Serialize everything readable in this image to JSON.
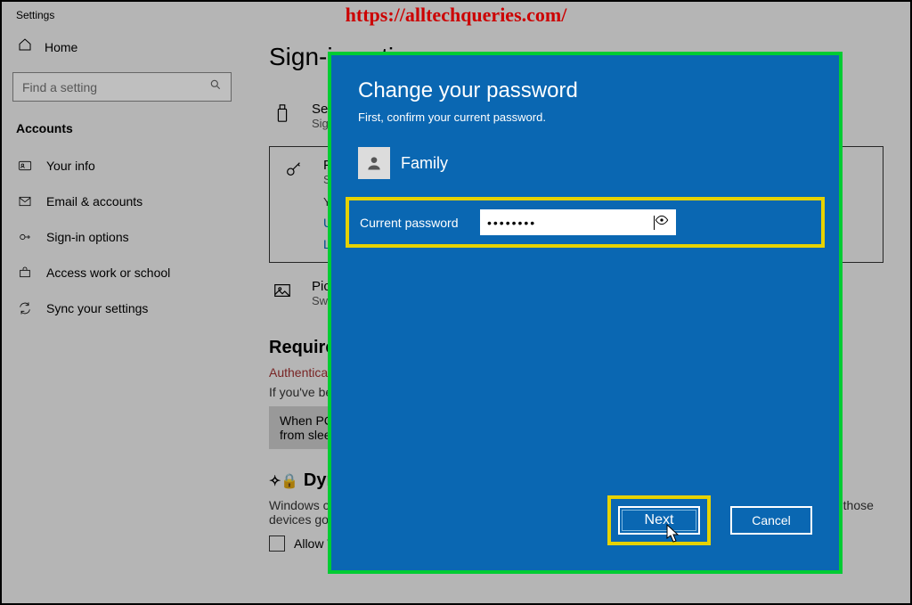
{
  "watermark_url": "https://alltechqueries.com/",
  "app_title": "Settings",
  "sidebar": {
    "home": "Home",
    "search_placeholder": "Find a setting",
    "section": "Accounts",
    "items": [
      {
        "label": "Your info"
      },
      {
        "label": "Email & accounts"
      },
      {
        "label": "Sign-in options"
      },
      {
        "label": "Access work or school"
      },
      {
        "label": "Sync your settings"
      }
    ]
  },
  "content": {
    "heading": "Sign-in options",
    "security_key": {
      "title": "Security Key",
      "sub": "Sign in with a physical security key"
    },
    "password": {
      "title": "Password",
      "sub": "Sign in with your account's password",
      "desc": "Your account password is all set up to sign in to Windows, apps, and services.",
      "update_link": "Update your security questions",
      "learn_link": "Learn more"
    },
    "picture": {
      "title": "Picture Password",
      "sub": "Swipe and tap your favorite photo to unlock your device"
    },
    "require": {
      "heading": "Require sign-in",
      "warn": "Authentication is required when this device wakes from sleep.",
      "desc": "If you've been away, when should Windows require you to sign in again?",
      "dropdown": "When PC wakes up from sleep"
    },
    "dynamic": {
      "heading": "Dynamic lock",
      "desc": "Windows can use devices that are paired to your PC to know when you're away and lock your PC when those devices go out of range.",
      "checkbox": "Allow Windows to automatically lock your device when you're away"
    }
  },
  "modal": {
    "title": "Change your password",
    "sub": "First, confirm your current password.",
    "user": "Family",
    "field_label": "Current password",
    "password_dots": "••••••••",
    "next": "Next",
    "cancel": "Cancel"
  }
}
